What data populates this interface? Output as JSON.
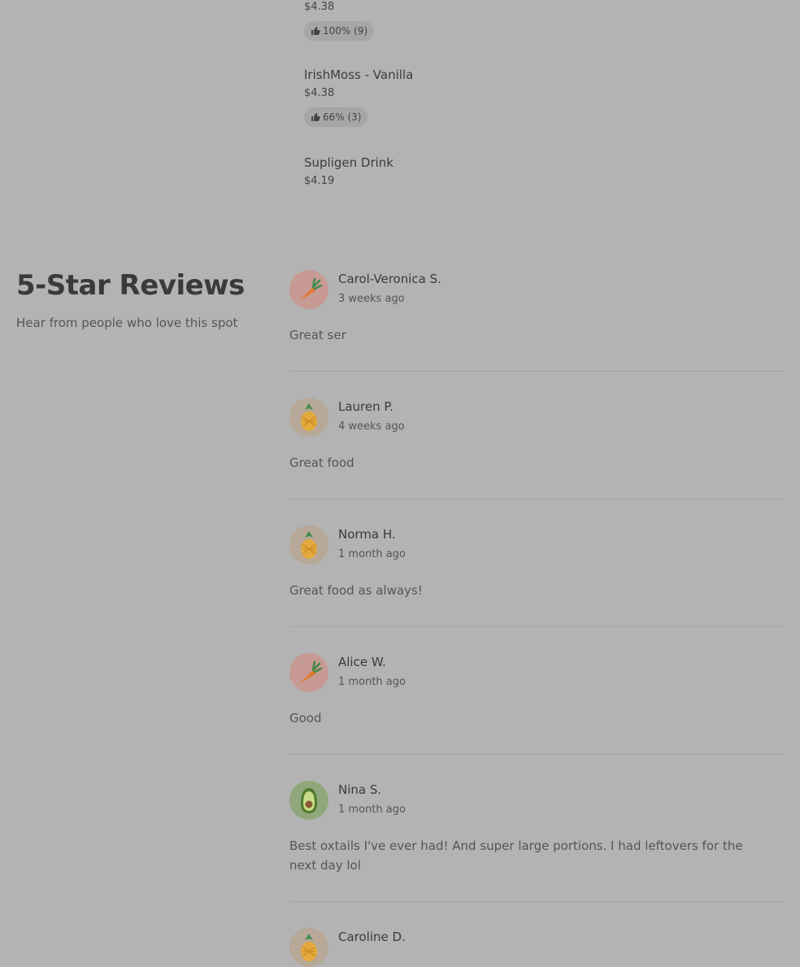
{
  "menu_items": [
    {
      "name": "",
      "price": "$4.38",
      "rating": "100% (9)"
    },
    {
      "name": "IrishMoss - Vanilla",
      "price": "$4.38",
      "rating": "66% (3)"
    },
    {
      "name": "Supligen Drink",
      "price": "$4.19",
      "rating": null
    }
  ],
  "reviews_section": {
    "title": "5-Star Reviews",
    "subtitle": "Hear from people who love this spot"
  },
  "reviews": [
    {
      "name": "Carol-Veronica S.",
      "date": "3 weeks ago",
      "text": "Great ser",
      "avatar": "carrot-icon"
    },
    {
      "name": "Lauren P.",
      "date": "4 weeks ago",
      "text": "Great food",
      "avatar": "pineapple-icon"
    },
    {
      "name": "Norma H.",
      "date": "1 month ago",
      "text": "Great food as always!",
      "avatar": "pineapple-icon"
    },
    {
      "name": "Alice W.",
      "date": "1 month ago",
      "text": "Good",
      "avatar": "carrot-icon"
    },
    {
      "name": "Nina S.",
      "date": "1 month ago",
      "text": "Best oxtails I've ever had! And super large portions. I had leftovers for the next day lol",
      "avatar": "avocado-icon"
    },
    {
      "name": "Caroline D.",
      "date": "",
      "text": "",
      "avatar": "pineapple-icon"
    }
  ],
  "colors": {
    "background": "#b3b3b3",
    "pill": "#a6a6a6",
    "divider": "#a4a4a4"
  }
}
